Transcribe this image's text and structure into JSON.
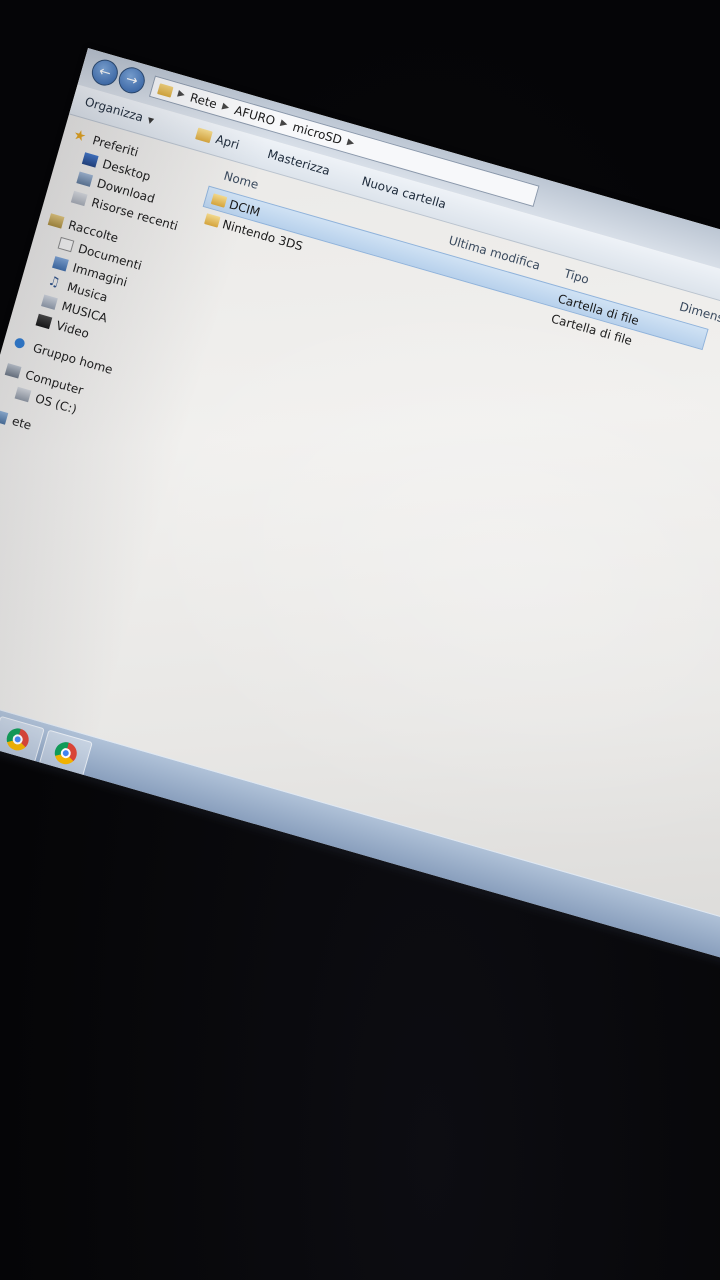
{
  "window": {
    "address_bar": {
      "path": [
        "Rete",
        "AFURO",
        "microSD"
      ]
    },
    "toolbar": {
      "organizza_label": "Organizza",
      "apri_label": "Apri",
      "masterizza_label": "Masterizza",
      "nuova_cartella_label": "Nuova cartella"
    },
    "sidebar": {
      "preferiti": {
        "label": "Preferiti",
        "items": [
          "Desktop",
          "Download",
          "Risorse recenti"
        ]
      },
      "raccolte": {
        "label": "Raccolte",
        "items": [
          "Documenti",
          "Immagini",
          "Musica",
          "MUSICA",
          "Video"
        ]
      },
      "gruppo_home": "Gruppo home",
      "computer": {
        "label": "Computer",
        "items": [
          "OS (C:)"
        ]
      },
      "rete": "ete"
    },
    "content": {
      "columns": {
        "nome": "Nome",
        "ultima_modifica": "Ultima modifica",
        "tipo": "Tipo",
        "dimensione": "Dimensione"
      },
      "files": [
        {
          "name": "DCIM",
          "type": "Cartella di file",
          "selected": true
        },
        {
          "name": "Nintendo 3DS",
          "type": "Cartella di file",
          "selected": false
        }
      ]
    }
  },
  "taskbar": {
    "icons": [
      "explorer-icon",
      "chrome-icon",
      "chrome-icon"
    ]
  }
}
